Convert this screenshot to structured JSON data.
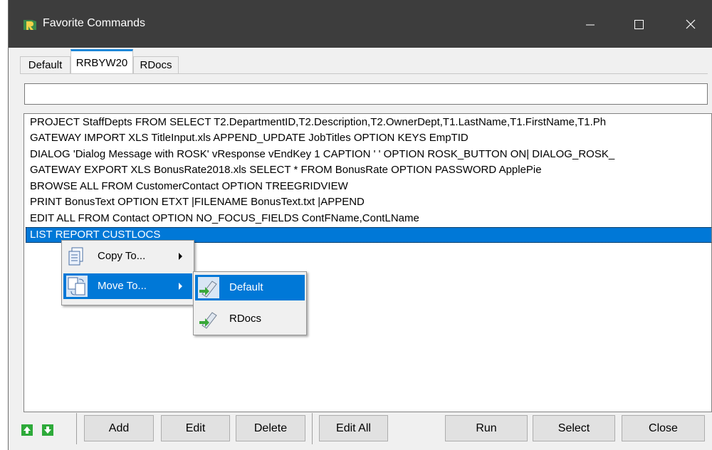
{
  "window": {
    "title": "Favorite Commands",
    "minimize_glyph": "—",
    "maximize_glyph": "☐",
    "close_glyph": "✕"
  },
  "tabs": [
    {
      "label": "Default",
      "active": false
    },
    {
      "label": "RRBYW20",
      "active": true
    },
    {
      "label": "RDocs",
      "active": false
    }
  ],
  "command_input": {
    "value": ""
  },
  "commands": [
    "PROJECT StaffDepts FROM SELECT T2.DepartmentID,T2.Description,T2.OwnerDept,T1.LastName,T1.FirstName,T1.Ph",
    "GATEWAY IMPORT XLS TitleInput.xls APPEND_UPDATE JobTitles OPTION KEYS EmpTID",
    "DIALOG 'Dialog Message with ROSK' vResponse vEndKey 1 CAPTION ' ' OPTION ROSK_BUTTON ON| DIALOG_ROSK_",
    "GATEWAY EXPORT XLS BonusRate2018.xls SELECT * FROM BonusRate OPTION PASSWORD ApplePie",
    "BROWSE ALL FROM CustomerContact OPTION TREEGRIDVIEW",
    "PRINT BonusText OPTION ETXT |FILENAME BonusText.txt |APPEND",
    "EDIT ALL FROM Contact OPTION NO_FOCUS_FIELDS ContFName,ContLName",
    "LIST REPORT CUSTLOCS"
  ],
  "selected_index": 7,
  "context_menu": {
    "items": [
      {
        "label": "Copy To...",
        "icon": "copy-to-icon"
      },
      {
        "label": "Move To...",
        "icon": "move-to-icon",
        "highlighted": true
      }
    ]
  },
  "submenu": {
    "items": [
      {
        "label": "Default",
        "icon": "tab-target-icon",
        "highlighted": true
      },
      {
        "label": "RDocs",
        "icon": "tab-target-icon"
      }
    ]
  },
  "toolbar": {
    "move_up_icon": "arrow-up-icon",
    "move_down_icon": "arrow-down-icon",
    "add_label": "Add",
    "edit_label": "Edit",
    "delete_label": "Delete",
    "edit_all_label": "Edit All",
    "run_label": "Run",
    "select_label": "Select",
    "close_label": "Close"
  },
  "colors": {
    "titlebar": "#3d3d3d",
    "selection": "#0078d7",
    "active_tab_accent": "#1e87d8",
    "arrow_button": "#2eaa3a"
  }
}
